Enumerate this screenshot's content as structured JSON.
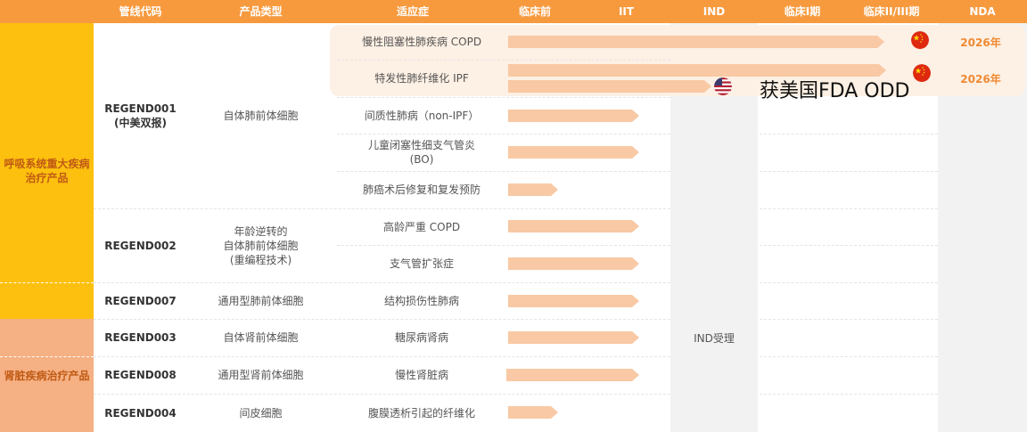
{
  "header": {
    "code": "管线代码",
    "type": "产品类型",
    "indication": "适应症",
    "preclinical": "临床前",
    "iit": "IIT",
    "ind": "IND",
    "phase1": "临床I期",
    "phase23": "临床II/III期",
    "nda": "NDA"
  },
  "categories": {
    "respiratory": "呼吸系统重大疾病治疗产品",
    "kidney": "肾脏疾病治疗产品"
  },
  "pipelines": [
    {
      "code": "REGEND001",
      "sub": "(中美双报)",
      "type": "自体肺前体细胞"
    },
    {
      "code": "REGEND002",
      "type_lines": [
        "年龄逆转的",
        "自体肺前体细胞",
        "(重编程技术)"
      ]
    },
    {
      "code": "REGEND007",
      "type": "通用型肺前体细胞"
    },
    {
      "code": "REGEND003",
      "type": "自体肾前体细胞"
    },
    {
      "code": "REGEND008",
      "type": "通用型肾前体细胞"
    },
    {
      "code": "REGEND004",
      "type": "间皮细胞"
    }
  ],
  "indications": [
    "慢性阻塞性肺疾病 COPD",
    "特发性肺纤维化 IPF",
    "间质性肺病（non-IPF）",
    "儿童闭塞性细支气管炎",
    "(BO)",
    "肺癌术后修复和复发预防",
    "高龄严重 COPD",
    "支气管扩张症",
    "结构损伤性肺病",
    "糖尿病肾病",
    "慢性肾脏病",
    "腹膜透析引起的纤维化"
  ],
  "years": [
    "2026年",
    "2026年"
  ],
  "odd_text": "获美国FDA ODD",
  "ind_accepted": "IND受理",
  "colors": {
    "header": "#f79a3e",
    "resp_category": "#fdc00f",
    "kidney_category": "#f5b083",
    "bar": "#f8c9a4",
    "highlight": "#fdf0e4",
    "gray_column": "#f2f2f2",
    "year": "#f08a34"
  },
  "icons": {
    "china_flag": "china-flag-icon",
    "us_flag": "us-flag-icon"
  }
}
